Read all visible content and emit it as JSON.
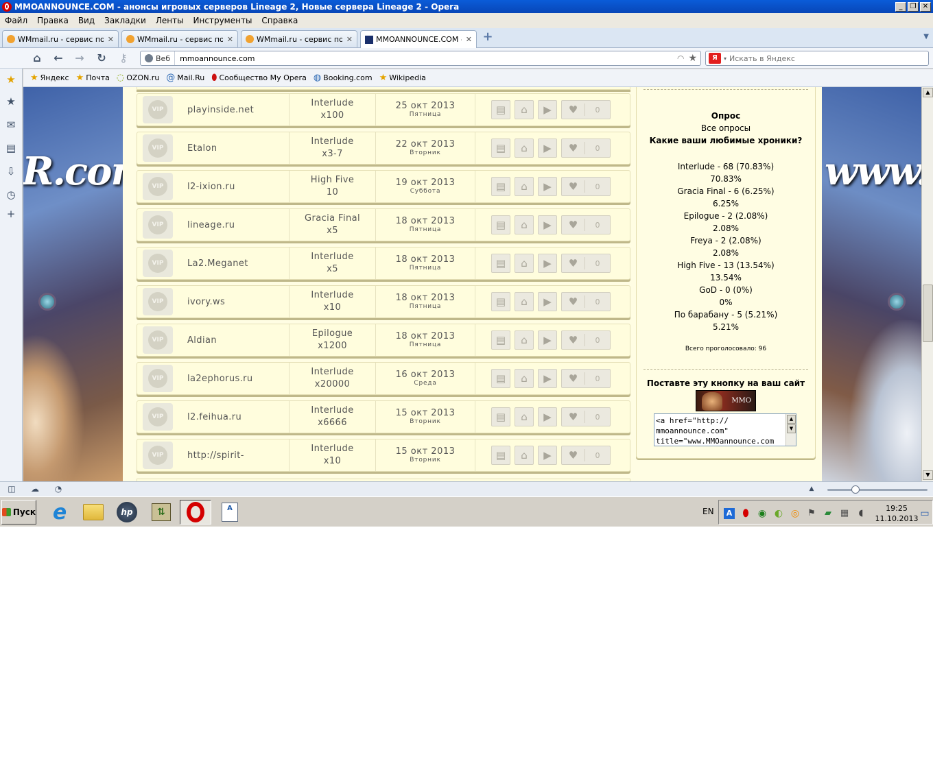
{
  "window": {
    "title": "MMOANNOUNCE.COM - анонсы игровых серверов Lineage 2, Новые сервера Lineage 2 - Opera",
    "minimize": "_",
    "restore": "❐",
    "close": "✕"
  },
  "menu": [
    "Файл",
    "Правка",
    "Вид",
    "Закладки",
    "Ленты",
    "Инструменты",
    "Справка"
  ],
  "tabs": [
    {
      "label": "WMmail.ru - сервис поч...",
      "close": "✕"
    },
    {
      "label": "WMmail.ru - сервис поч...",
      "close": "✕"
    },
    {
      "label": "WMmail.ru - сервис поч...",
      "close": "✕"
    },
    {
      "label": "MMOANNOUNCE.COM - ...",
      "close": "✕"
    }
  ],
  "tab_add": "+",
  "address": {
    "web_label": "Веб",
    "url": "mmoannounce.com"
  },
  "search": {
    "engine": "Я",
    "placeholder": "Искать в Яндекс"
  },
  "bookmarks": [
    {
      "label": "Яндекс",
      "icon": "star-icon"
    },
    {
      "label": "Почта",
      "icon": "star-icon"
    },
    {
      "label": "OZON.ru",
      "icon": "ozon-icon"
    },
    {
      "label": "Mail.Ru",
      "icon": "mailru-icon"
    },
    {
      "label": "Сообщество My Opera",
      "icon": "opera-icon"
    },
    {
      "label": "Booking.com",
      "icon": "globe-icon"
    },
    {
      "label": "Wikipedia",
      "icon": "star-icon"
    }
  ],
  "background": {
    "left_brand": "R.com",
    "right_brand": "www.L"
  },
  "servers": [
    {
      "vip": "VIP",
      "name": "playinside.net",
      "chronicle": "Interlude",
      "rate": "x100",
      "date": "25 окт 2013",
      "weekday": "Пятница",
      "likes": "0"
    },
    {
      "vip": "VIP",
      "name": "Etalon",
      "chronicle": "Interlude",
      "rate": "x3-7",
      "date": "22 окт 2013",
      "weekday": "Вторник",
      "likes": "0"
    },
    {
      "vip": "VIP",
      "name": "l2-ixion.ru",
      "chronicle": "High Five",
      "rate": "10",
      "date": "19 окт 2013",
      "weekday": "Суббота",
      "likes": "0"
    },
    {
      "vip": "VIP",
      "name": "lineage.ru",
      "chronicle": "Gracia Final",
      "rate": "x5",
      "date": "18 окт 2013",
      "weekday": "Пятница",
      "likes": "0"
    },
    {
      "vip": "VIP",
      "name": "La2.Meganet",
      "chronicle": "Interlude",
      "rate": "x5",
      "date": "18 окт 2013",
      "weekday": "Пятница",
      "likes": "0"
    },
    {
      "vip": "VIP",
      "name": "ivory.ws",
      "chronicle": "Interlude",
      "rate": "x10",
      "date": "18 окт 2013",
      "weekday": "Пятница",
      "likes": "0"
    },
    {
      "vip": "VIP",
      "name": "Aldian",
      "chronicle": "Epilogue",
      "rate": "x1200",
      "date": "18 окт 2013",
      "weekday": "Пятница",
      "likes": "0"
    },
    {
      "vip": "VIP",
      "name": "la2ephorus.ru",
      "chronicle": "Interlude",
      "rate": "x20000",
      "date": "16 окт 2013",
      "weekday": "Среда",
      "likes": "0"
    },
    {
      "vip": "VIP",
      "name": "l2.feihua.ru",
      "chronicle": "Interlude",
      "rate": "x6666",
      "date": "15 окт 2013",
      "weekday": "Вторник",
      "likes": "0"
    },
    {
      "vip": "VIP",
      "name": "http://spirit-",
      "chronicle": "Interlude",
      "rate": "x10",
      "date": "15 окт 2013",
      "weekday": "Вторник",
      "likes": "0"
    }
  ],
  "poll": {
    "title": "Опрос",
    "all_link": "Все опросы",
    "question": "Какие ваши любимые хроники?",
    "options": [
      {
        "label": "Interlude - 68 (70.83%)",
        "percent": "70.83%"
      },
      {
        "label": "Gracia Final - 6 (6.25%)",
        "percent": "6.25%"
      },
      {
        "label": "Epilogue - 2 (2.08%)",
        "percent": "2.08%"
      },
      {
        "label": "Freya - 2 (2.08%)",
        "percent": "2.08%"
      },
      {
        "label": "High Five - 13 (13.54%)",
        "percent": "13.54%"
      },
      {
        "label": "GoD - 0 (0%)",
        "percent": "0%"
      },
      {
        "label": "По барабану - 5 (5.21%)",
        "percent": "5.21%"
      }
    ],
    "total": "Всего проголосовало: 96",
    "button_title": "Поставте эту кнопку на ваш сайт",
    "banner_text": "MMO",
    "code": "<a href=\"http://\nmmoannounce.com\"\ntitle=\"www.MMOannounce.com"
  },
  "taskbar": {
    "start": "Пуск",
    "lang": "EN",
    "time": "19:25",
    "date": "11.10.2013",
    "tray_a": "A"
  }
}
